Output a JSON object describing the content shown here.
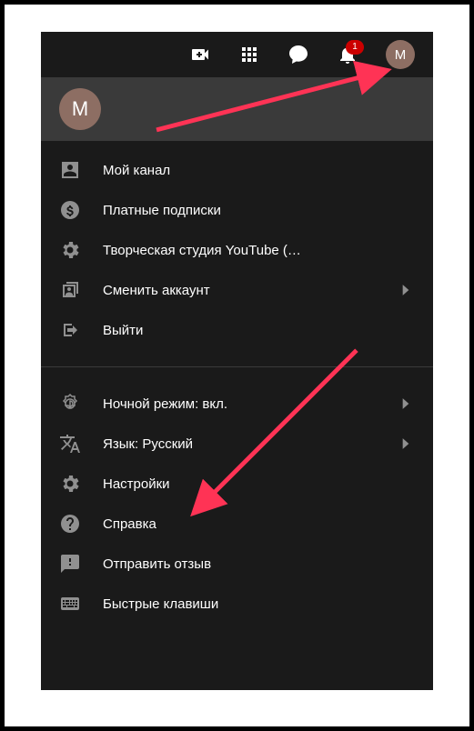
{
  "topbar": {
    "avatar_initial": "M",
    "notification_count": "1"
  },
  "account_strip": {
    "avatar_initial": "M"
  },
  "menu_section1": [
    {
      "id": "my-channel",
      "label": "Мой канал"
    },
    {
      "id": "paid",
      "label": "Платные подписки"
    },
    {
      "id": "studio",
      "label": "Творческая студия YouTube (…"
    },
    {
      "id": "switch",
      "label": "Сменить аккаунт",
      "chevron": true
    },
    {
      "id": "signout",
      "label": "Выйти"
    }
  ],
  "menu_section2": [
    {
      "id": "darkmode",
      "label": "Ночной режим: вкл.",
      "chevron": true
    },
    {
      "id": "language",
      "label": "Язык: Русский",
      "chevron": true
    },
    {
      "id": "settings",
      "label": "Настройки"
    },
    {
      "id": "help",
      "label": "Справка"
    },
    {
      "id": "feedback",
      "label": "Отправить отзыв"
    },
    {
      "id": "shortcuts",
      "label": "Быстрые клавиши"
    }
  ],
  "annotation": {
    "arrow_color": "#ff3355"
  }
}
